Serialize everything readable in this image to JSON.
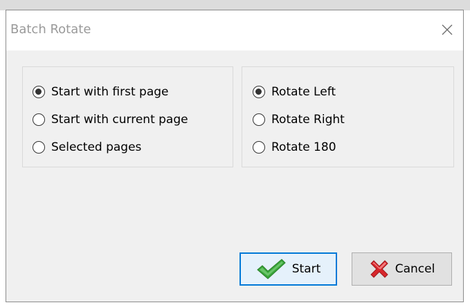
{
  "window": {
    "title": "Batch Rotate",
    "close_icon": "close-icon"
  },
  "page_options": [
    {
      "label": "Start with first page",
      "selected": true
    },
    {
      "label": "Start with current page",
      "selected": false
    },
    {
      "label": "Selected pages",
      "selected": false
    }
  ],
  "rotate_options": [
    {
      "label": "Rotate Left",
      "selected": true
    },
    {
      "label": "Rotate Right",
      "selected": false
    },
    {
      "label": "Rotate 180",
      "selected": false
    }
  ],
  "buttons": {
    "start": {
      "label": "Start",
      "icon": "checkmark-icon"
    },
    "cancel": {
      "label": "Cancel",
      "icon": "red-x-icon"
    }
  },
  "colors": {
    "focus_border": "#0078d7",
    "dialog_background": "#f0f0f0",
    "checkmark_green": "#3aa63a",
    "cancel_red": "#d8262b"
  }
}
